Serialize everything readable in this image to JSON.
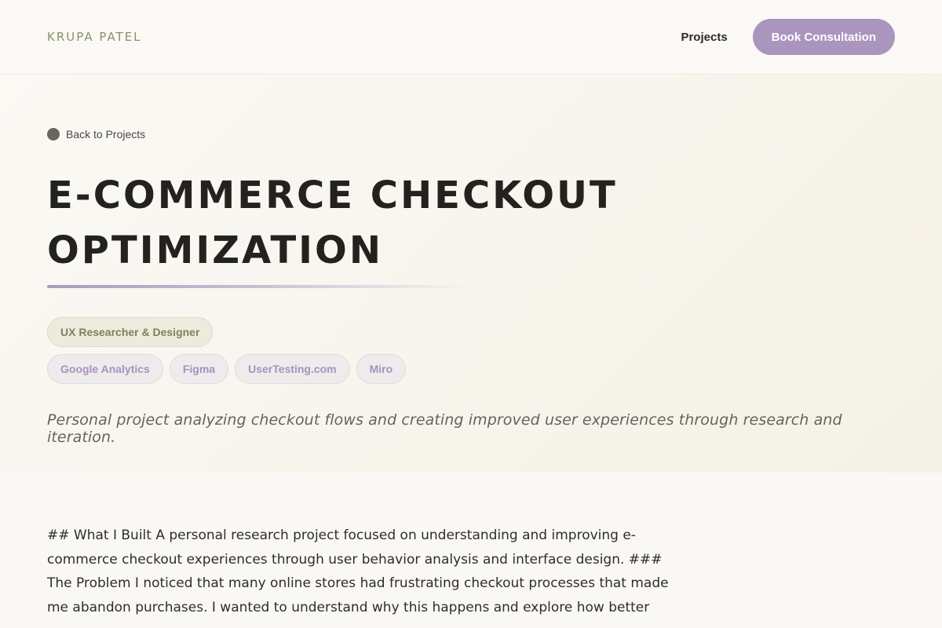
{
  "nav": {
    "logo": "KRUPA PATEL",
    "projects_link": "Projects",
    "cta_label": "Book Consultation"
  },
  "hero": {
    "back_label": "Back to Projects",
    "title": "E-COMMERCE CHECKOUT OPTIMIZATION",
    "role": "UX Researcher & Designer",
    "tools": [
      "Google Analytics",
      "Figma",
      "UserTesting.com",
      "Miro"
    ],
    "lede": "Personal project analyzing checkout flows and creating improved user experiences through research and iteration."
  },
  "content": {
    "body": "## What I Built A personal research project focused on understanding and improving e-commerce checkout experiences through user behavior analysis and interface design. ### The Problem I noticed that many online stores had frustrating checkout processes that made me abandon purchases. I wanted to understand why this happens and explore how better"
  },
  "colors": {
    "accent_purple": "#a995bd",
    "olive": "#8c9167",
    "background": "#faf8f4"
  },
  "icons": {
    "back": "back-arrow-icon"
  }
}
